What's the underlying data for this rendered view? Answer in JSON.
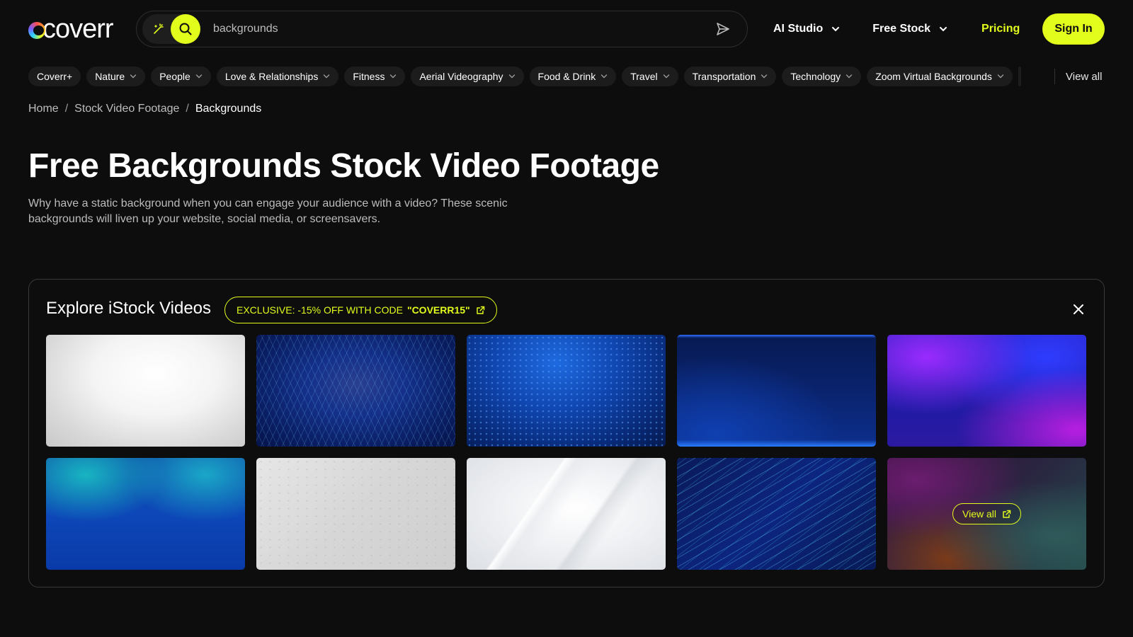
{
  "brand": {
    "name": "coverr",
    "accent_color": "#e2fc1c",
    "background": "#0d0d0d"
  },
  "header": {
    "search": {
      "value": "backgrounds",
      "placeholder": "backgrounds"
    },
    "nav": {
      "ai_studio": "AI Studio",
      "free_stock": "Free Stock",
      "pricing": "Pricing",
      "sign_in": "Sign In"
    },
    "icons": [
      "magic-wand-icon",
      "search-icon",
      "send-icon",
      "chevron-down-icon"
    ]
  },
  "categories": {
    "items": [
      {
        "label": "Coverr+",
        "has_dropdown": false
      },
      {
        "label": "Nature",
        "has_dropdown": true
      },
      {
        "label": "People",
        "has_dropdown": true
      },
      {
        "label": "Love & Relationships",
        "has_dropdown": true
      },
      {
        "label": "Fitness",
        "has_dropdown": true
      },
      {
        "label": "Aerial Videography",
        "has_dropdown": true
      },
      {
        "label": "Food & Drink",
        "has_dropdown": true
      },
      {
        "label": "Travel",
        "has_dropdown": true
      },
      {
        "label": "Transportation",
        "has_dropdown": true
      },
      {
        "label": "Technology",
        "has_dropdown": true
      },
      {
        "label": "Zoom Virtual Backgrounds",
        "has_dropdown": true
      }
    ],
    "view_all": "View all"
  },
  "breadcrumb": {
    "home": "Home",
    "section": "Stock Video Footage",
    "current": "Backgrounds",
    "separator": "/"
  },
  "page": {
    "title": "Free Backgrounds Stock Video Footage",
    "description": "Why have a static background when you can engage your audience with a video? These scenic backgrounds will liven up your website, social media, or screensavers."
  },
  "istock": {
    "title": "Explore iStock Videos",
    "promo_text": "EXCLUSIVE: -15% OFF WITH CODE",
    "promo_code": "\"COVERR15\"",
    "view_all": "View all",
    "thumbnails": [
      {
        "name": "white-studio-background"
      },
      {
        "name": "blue-digital-tunnel"
      },
      {
        "name": "blue-dot-matrix"
      },
      {
        "name": "dark-blue-gradient"
      },
      {
        "name": "purple-blue-gradient"
      },
      {
        "name": "teal-blue-gradient"
      },
      {
        "name": "grey-concrete-texture"
      },
      {
        "name": "white-abstract-waves"
      },
      {
        "name": "blue-particle-streaks"
      },
      {
        "name": "purple-teal-gradient-view-all"
      }
    ]
  }
}
